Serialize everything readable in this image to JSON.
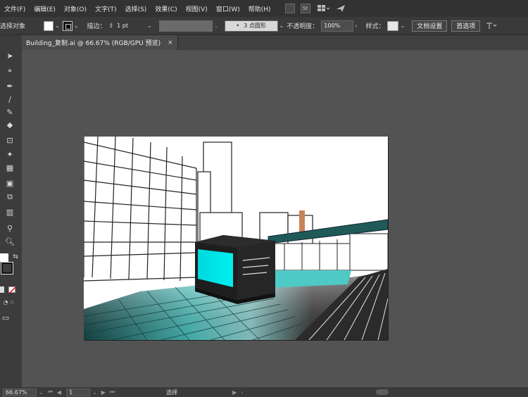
{
  "menubar": {
    "items": [
      "文件(F)",
      "编辑(E)",
      "对象(O)",
      "文字(T)",
      "选择(S)",
      "效果(C)",
      "视图(V)",
      "窗口(W)",
      "帮助(H)"
    ],
    "icons": [
      "bridge-icon",
      "stock-icon",
      "workspace-icon",
      "send-icon"
    ],
    "stock_label": "St"
  },
  "control_bar": {
    "selection_label": "选择对象",
    "stroke_label": "描边：",
    "stroke_value": "1 pt",
    "brush_label": "3 点圆形",
    "opacity_label": "不透明度：",
    "opacity_value": "100%",
    "style_label": "样式：",
    "doc_setup_button": "文档设置",
    "preferences_button": "首选项"
  },
  "document_tab": {
    "title": "Building_复制.ai @ 66.67% (RGB/GPU 预览)",
    "close": "×"
  },
  "status_bar": {
    "zoom": "66.67%",
    "page": "1",
    "tool_status": "选择"
  },
  "colors": {
    "accent_cyan": "#00e5e6",
    "ui_dark": "#323232",
    "canvas_gray": "#535353"
  }
}
